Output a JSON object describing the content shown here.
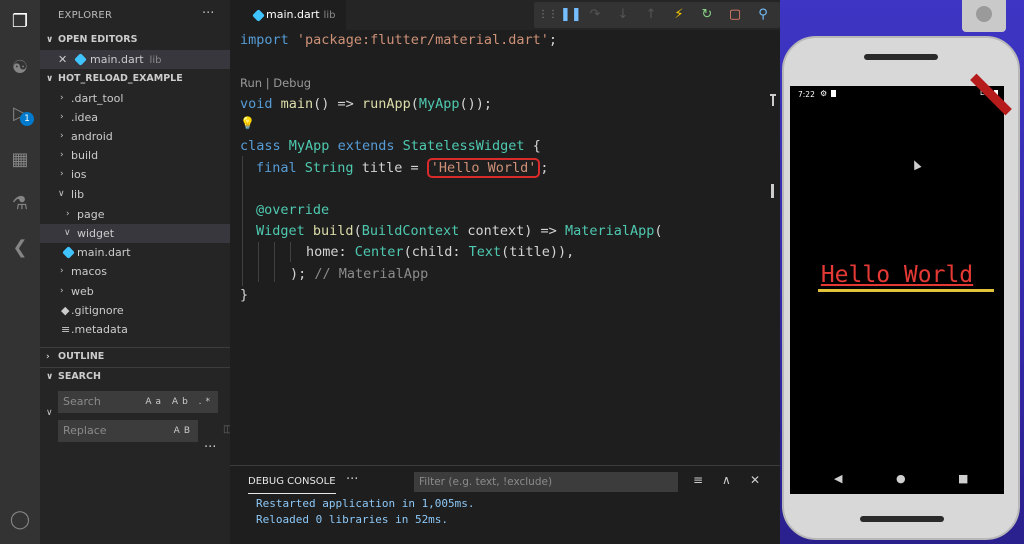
{
  "explorer": {
    "title": "EXPLORER",
    "more": "···",
    "open_editors_label": "OPEN EDITORS",
    "open_file": {
      "name": "main.dart",
      "folder": "lib"
    },
    "project_label": "HOT_RELOAD_EXAMPLE",
    "tree": [
      {
        "name": ".dart_tool",
        "type": "folder"
      },
      {
        "name": ".idea",
        "type": "folder"
      },
      {
        "name": "android",
        "type": "folder"
      },
      {
        "name": "build",
        "type": "folder"
      },
      {
        "name": "ios",
        "type": "folder"
      },
      {
        "name": "lib",
        "type": "folder-open"
      },
      {
        "name": "page",
        "type": "folder"
      },
      {
        "name": "widget",
        "type": "folder-open"
      },
      {
        "name": "main.dart",
        "type": "file"
      },
      {
        "name": "macos",
        "type": "folder"
      },
      {
        "name": "web",
        "type": "folder"
      },
      {
        "name": ".gitignore",
        "type": "file"
      },
      {
        "name": ".metadata",
        "type": "file"
      }
    ],
    "outline_label": "OUTLINE",
    "search_label": "SEARCH",
    "search_placeholder": "Search",
    "search_opts": "Aa Ab .*",
    "replace_placeholder": "Replace",
    "replace_opts": "AB",
    "search_more": "···"
  },
  "activity_badge": "1",
  "editor": {
    "tab_name": "main.dart",
    "tab_folder": "lib",
    "codelens": "Run | Debug",
    "code": {
      "l1_kw": "import",
      "l1_str": "'package:flutter/material.dart'",
      "l1_end": ";",
      "l2_kw": "void",
      "l2_fn": "main",
      "l2_mid": "() =>",
      "l2_call": "runApp",
      "l2_ty": "MyApp",
      "l2_end": "());",
      "l3_kw1": "class",
      "l3_ty1": "MyApp",
      "l3_kw2": "extends",
      "l3_ty2": "StatelessWidget",
      "l3_end": "{",
      "l4_kw": "final",
      "l4_ty": "String",
      "l4_mid": "title =",
      "l4_str": "'Hello World'",
      "l4_end": ";",
      "l5_ann": "@override",
      "l6_ty": "Widget",
      "l6_fn": "build",
      "l6_ty2": "BuildContext",
      "l6_mid": "context) =>",
      "l6_ty3": "MaterialApp",
      "l6_end": "(",
      "l7_a": "home:",
      "l7_ty": "Center",
      "l7_b": "(child:",
      "l7_ty2": "Text",
      "l7_c": "(title)),",
      "l8_a": ");",
      "l8_cm": "// MaterialApp",
      "l9": "}"
    }
  },
  "panel": {
    "tab_label": "DEBUG CONSOLE",
    "more": "···",
    "filter_placeholder": "Filter (e.g. text, !exclude)",
    "lines": [
      "Restarted application in 1,005ms.",
      "Reloaded 0 libraries in 52ms."
    ]
  },
  "emulator": {
    "time": "7:22",
    "network": "LTE",
    "hello_text": "Hello World"
  },
  "colors": {
    "accent": "#007acc",
    "highlight_box": "#d92b2b",
    "hello_red": "#e53935"
  }
}
